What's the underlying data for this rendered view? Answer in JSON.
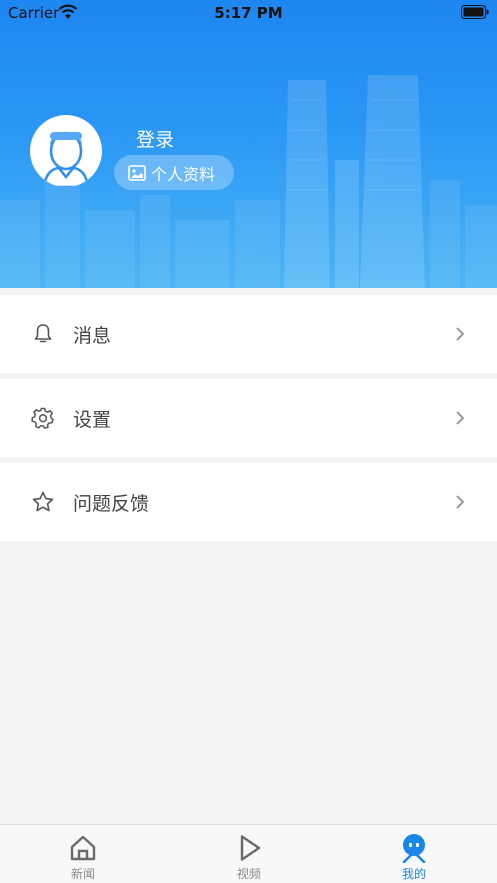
{
  "status_bar": {
    "carrier": "Carrier",
    "time": "5:17 PM"
  },
  "profile": {
    "login_label": "登录",
    "profile_button_label": "个人资料"
  },
  "menu": {
    "items": [
      {
        "label": "消息",
        "icon": "bell-icon"
      },
      {
        "label": "设置",
        "icon": "gear-icon"
      },
      {
        "label": "问题反馈",
        "icon": "star-icon"
      }
    ]
  },
  "tab_bar": {
    "tabs": [
      {
        "label": "新闻",
        "icon": "home-icon",
        "active": false
      },
      {
        "label": "视频",
        "icon": "play-icon",
        "active": false
      },
      {
        "label": "我的",
        "icon": "face-icon",
        "active": true
      }
    ]
  },
  "colors": {
    "header_top": "#1e86f0",
    "header_bottom": "#4db5f5",
    "accent": "#1a87e8",
    "page_background": "#f3f3f3"
  }
}
